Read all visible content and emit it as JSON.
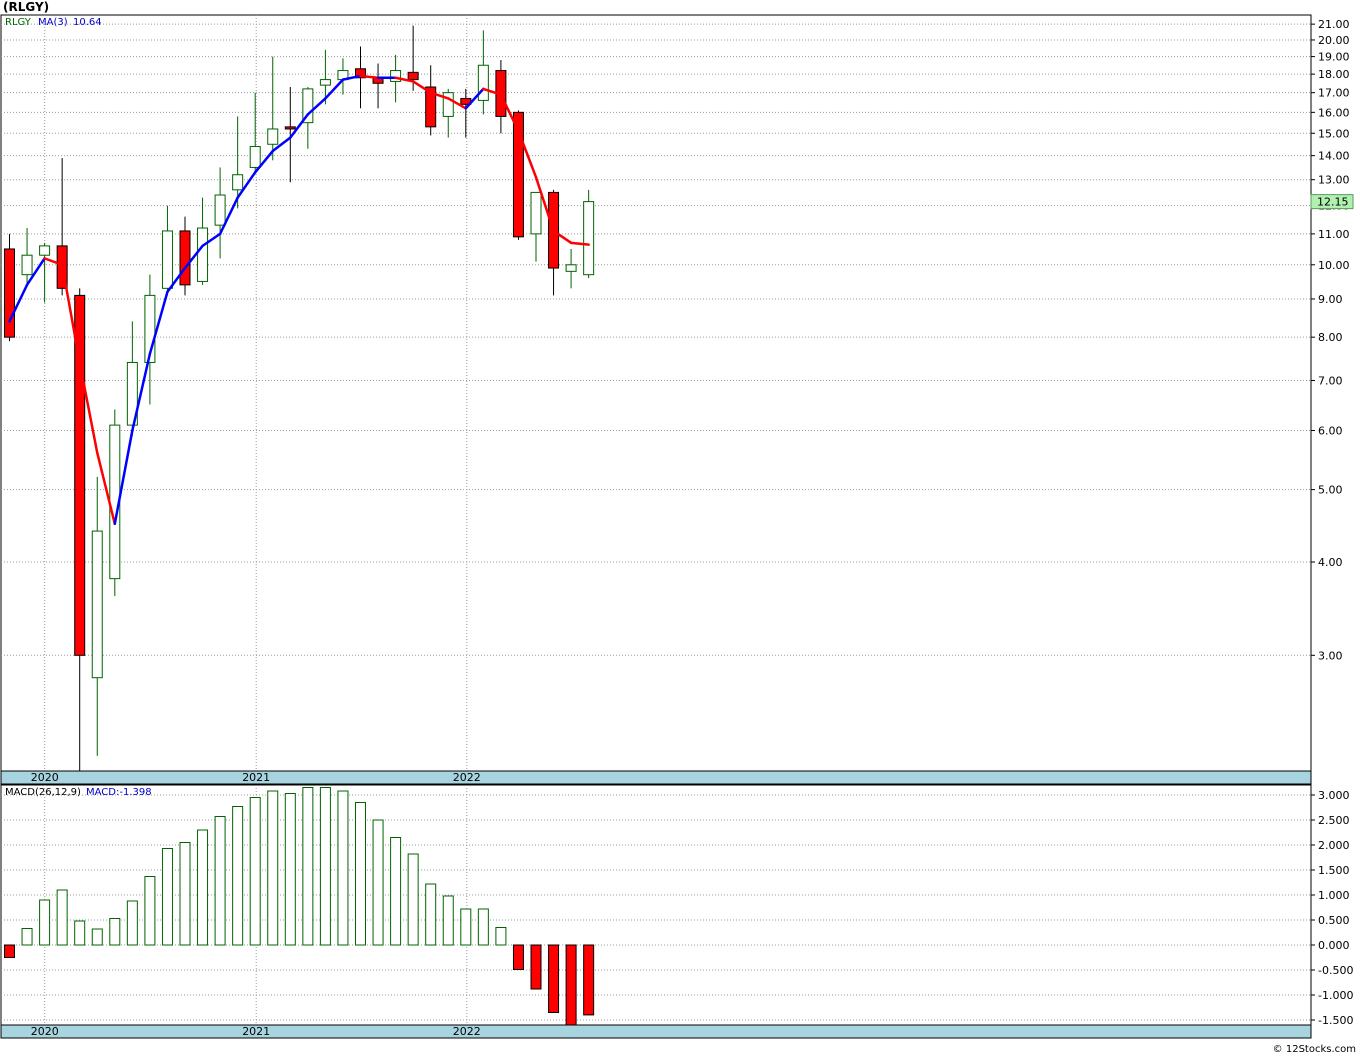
{
  "title": "(RLGY)",
  "credit": "© 12Stocks.com",
  "legend": {
    "symbol": "RLGY",
    "ma_label": "MA(3)",
    "ma_value": "10.64",
    "macd_label": "MACD(26,12,9)",
    "macd_value": "MACD:-1.398"
  },
  "colors": {
    "up_candle": "#006400",
    "down_candle": "#ff0000",
    "ma_up": "#0000ff",
    "ma_down": "#ff0000",
    "axis_band": "#a8d4e0",
    "last_price_box": "#b0f0b0"
  },
  "chart_data": [
    {
      "type": "candlestick",
      "scale": "log",
      "ylim": [
        2.1,
        21.6
      ],
      "y_ticks": [
        "21.00",
        "20.00",
        "19.00",
        "18.00",
        "17.00",
        "16.00",
        "15.00",
        "14.00",
        "13.00",
        "12.00",
        "11.00",
        "10.00",
        "9.00",
        "8.00",
        "7.00",
        "6.00",
        "5.00",
        "4.00",
        "3.00"
      ],
      "x_labels": [
        "2020",
        "2021",
        "2022"
      ],
      "last_price": "12.15",
      "series": [
        {
          "name": "RLGY",
          "ohlc": [
            [
              10.5,
              11.0,
              7.9,
              8.0
            ],
            [
              9.7,
              11.2,
              9.4,
              10.3
            ],
            [
              10.3,
              10.7,
              8.9,
              10.6
            ],
            [
              10.6,
              13.9,
              9.1,
              9.3
            ],
            [
              9.1,
              9.3,
              2.1,
              3.0
            ],
            [
              2.8,
              5.2,
              2.2,
              4.4
            ],
            [
              3.8,
              6.4,
              3.6,
              6.1
            ],
            [
              6.1,
              8.4,
              5.9,
              7.4
            ],
            [
              7.4,
              9.7,
              6.5,
              9.1
            ],
            [
              9.3,
              12.0,
              9.1,
              11.1
            ],
            [
              11.1,
              11.6,
              9.1,
              9.4
            ],
            [
              9.5,
              12.3,
              9.4,
              11.2
            ],
            [
              11.3,
              13.5,
              10.2,
              12.4
            ],
            [
              12.6,
              15.8,
              11.9,
              13.2
            ],
            [
              13.5,
              17.0,
              13.3,
              14.4
            ],
            [
              14.5,
              19.0,
              13.8,
              15.2
            ],
            [
              15.3,
              17.3,
              12.9,
              15.2
            ],
            [
              15.5,
              17.3,
              14.3,
              17.2
            ],
            [
              17.4,
              19.4,
              16.4,
              17.7
            ],
            [
              17.7,
              18.9,
              16.9,
              18.2
            ],
            [
              18.3,
              19.6,
              16.2,
              17.8
            ],
            [
              17.8,
              18.6,
              16.2,
              17.5
            ],
            [
              17.6,
              19.1,
              16.5,
              18.2
            ],
            [
              18.1,
              20.9,
              17.1,
              17.7
            ],
            [
              17.3,
              18.5,
              14.9,
              15.3
            ],
            [
              15.8,
              17.2,
              14.8,
              17.0
            ],
            [
              16.7,
              17.2,
              14.8,
              16.4
            ],
            [
              16.6,
              20.6,
              15.9,
              18.5
            ],
            [
              18.2,
              18.8,
              15.0,
              15.8
            ],
            [
              16.0,
              16.1,
              10.8,
              10.9
            ],
            [
              11.0,
              12.5,
              10.1,
              12.5
            ],
            [
              12.5,
              12.6,
              9.1,
              9.9
            ],
            [
              9.8,
              10.5,
              9.3,
              10.0
            ],
            [
              9.7,
              12.6,
              9.6,
              12.15
            ]
          ]
        },
        {
          "name": "MA(3)",
          "values": [
            8.4,
            9.4,
            10.2,
            10.0,
            7.4,
            5.6,
            4.5,
            6.0,
            7.6,
            9.2,
            9.9,
            10.6,
            11.0,
            12.3,
            13.3,
            14.2,
            14.8,
            15.9,
            16.7,
            17.7,
            17.9,
            17.8,
            17.8,
            17.6,
            17.0,
            16.7,
            16.2,
            17.2,
            16.9,
            15.1,
            13.1,
            11.1,
            10.7,
            10.64
          ]
        }
      ]
    },
    {
      "type": "bar",
      "title": "MACD(26,12,9)",
      "ylim": [
        -1.6,
        3.2
      ],
      "y_ticks": [
        "3.000",
        "2.500",
        "2.000",
        "1.500",
        "1.000",
        "0.500",
        "0.000",
        "-0.500",
        "-1.000",
        "-1.500"
      ],
      "x_labels": [
        "2020",
        "2021",
        "2022"
      ],
      "series": [
        {
          "name": "MACD",
          "values": [
            -0.25,
            0.33,
            0.9,
            1.1,
            0.48,
            0.32,
            0.53,
            0.88,
            1.37,
            1.93,
            2.05,
            2.3,
            2.57,
            2.77,
            2.95,
            3.08,
            3.03,
            3.15,
            3.15,
            3.08,
            2.85,
            2.5,
            2.15,
            1.82,
            1.22,
            0.98,
            0.72,
            0.72,
            0.35,
            -0.49,
            -0.88,
            -1.35,
            -1.62,
            -1.398
          ]
        }
      ]
    }
  ]
}
